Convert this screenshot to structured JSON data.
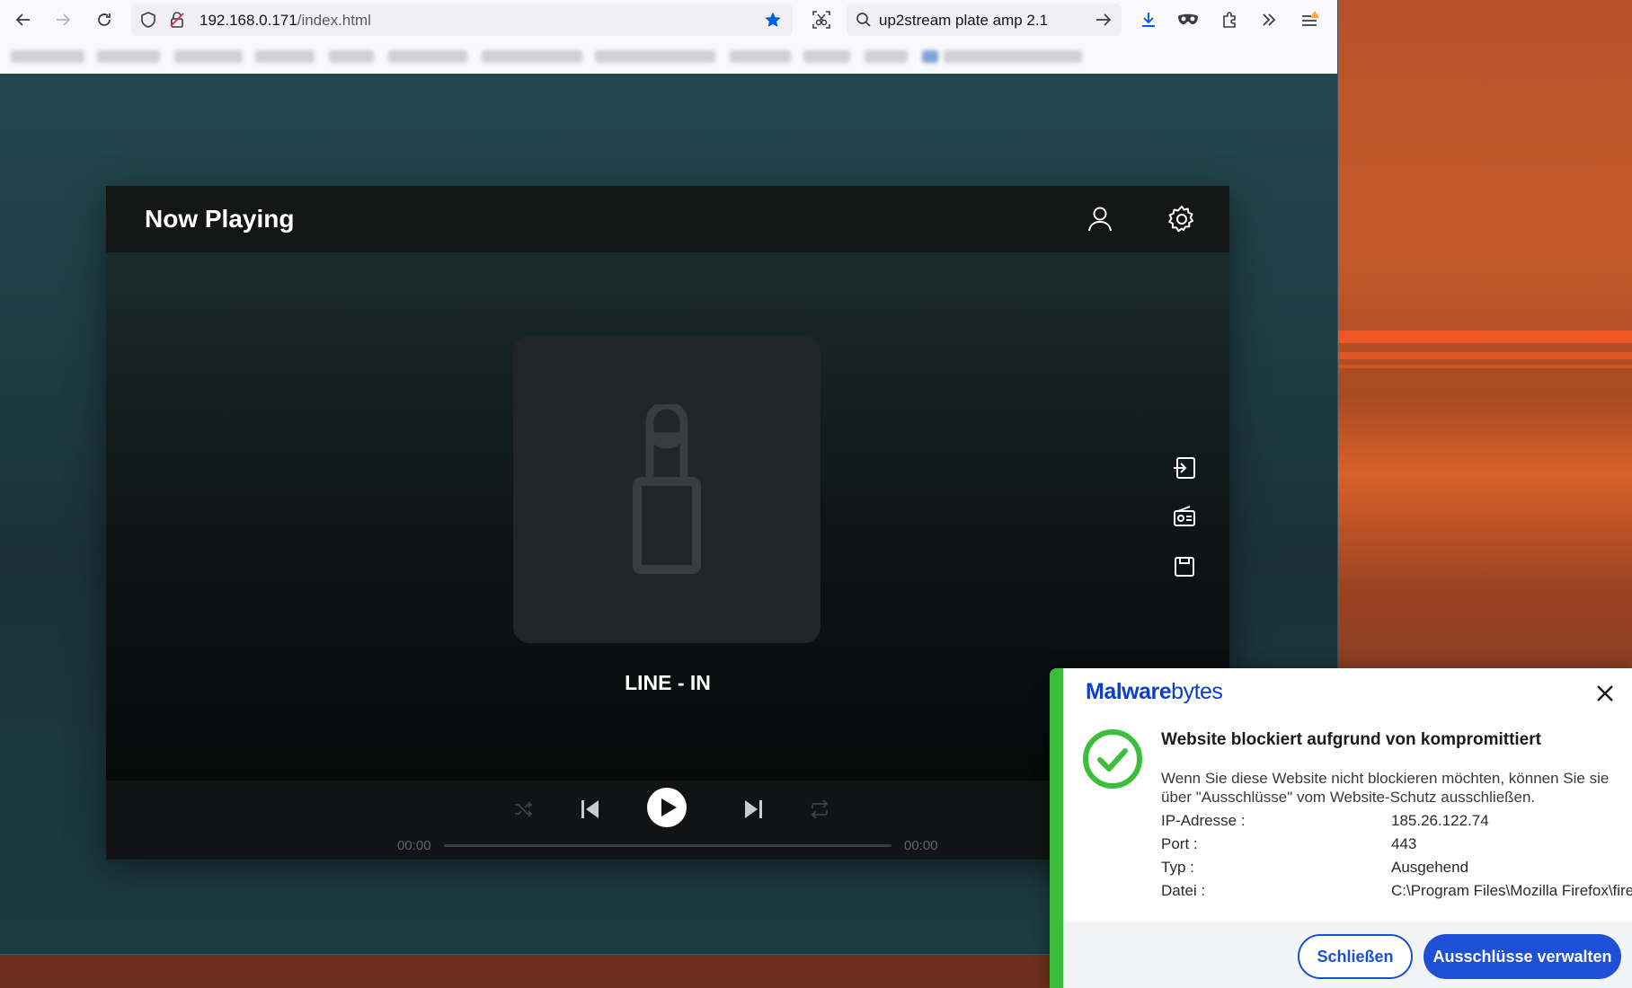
{
  "browser": {
    "url_host": "192.168.0.171",
    "url_path": "/index.html",
    "search_query": "up2stream plate amp 2.1",
    "bookmarks_count_visible": 13
  },
  "player": {
    "title": "Now Playing",
    "source": "LINE - IN",
    "time_elapsed": "00:00",
    "time_total": "00:00",
    "progress": 0
  },
  "toast": {
    "brand_prefix": "M",
    "brand_bold": "alware",
    "brand_rest": "bytes",
    "heading": "Website blockiert aufgrund von kompromittiert",
    "message": "Wenn Sie diese Website nicht blockieren möchten, können Sie sie über \"Ausschlüsse\" vom Website-Schutz ausschließen.",
    "rows": [
      {
        "label": "IP-Adresse :",
        "value": "185.26.122.74"
      },
      {
        "label": "Port :",
        "value": "443"
      },
      {
        "label": "Typ :",
        "value": "Ausgehend"
      },
      {
        "label": "Datei :",
        "value": "C:\\Program Files\\Mozilla Firefox\\firefox.exe"
      }
    ],
    "close_label": "Schließen",
    "manage_label": "Ausschlüsse verwalten",
    "accent_color": "#3bbf3b",
    "brand_color": "#0d3ecc"
  }
}
